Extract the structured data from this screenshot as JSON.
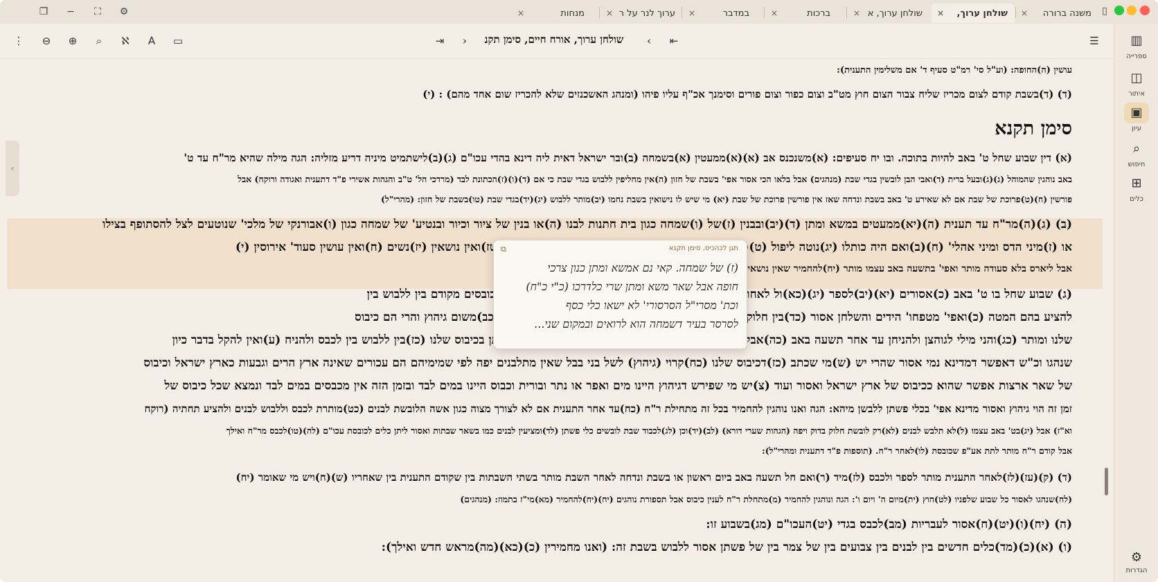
{
  "tabs": [
    {
      "label": "משנה ברורה",
      "active": false
    },
    {
      "label": "שולחן ערוך,",
      "active": true
    },
    {
      "label": "שולחן ערוך, א",
      "active": false
    },
    {
      "label": "ברכות",
      "active": false
    },
    {
      "label": "במדבר",
      "active": false
    },
    {
      "label": "ערוך לנר על ר",
      "active": false
    },
    {
      "label": "מנחות",
      "active": false
    }
  ],
  "tab_close_glyph": "×",
  "toolbar": {
    "title": "שולחן ערוך, אורח חיים, סימן תקנ",
    "icons": [
      "menu-icon",
      "first-page-icon",
      "prev-icon",
      "next-icon",
      "last-page-icon",
      "sidebar-toggle-icon",
      "font-size-icon",
      "nikud-icon",
      "search-icon",
      "zoom-in-icon",
      "zoom-out-icon",
      "more-icon"
    ]
  },
  "sidebar": {
    "items": [
      {
        "label": "ספרייה",
        "icon": "library-icon",
        "active": false
      },
      {
        "label": "איתור",
        "icon": "find-icon",
        "active": false
      },
      {
        "label": "עיון",
        "icon": "book-icon",
        "active": true
      },
      {
        "label": "חיפוש",
        "icon": "search-icon",
        "active": false
      },
      {
        "label": "כלים",
        "icon": "tools-icon",
        "active": false
      }
    ],
    "settings_label": "הגדרות"
  },
  "content": {
    "lines": [
      "עושין (ה)החופה: (וע\"ל סי' רמ\"ט סעיף ד' אם משלימין התענית):",
      "(ד) (ד)בשבת קודם לצום מכריז שליח צבור הצום חוץ מט\"ב וצום כפור וצום פורים וסימנך אכ\"ף עליו פיהו (ומנהג האשכנזים שלא להכריז שום אחד מהם) : (י)",
      "סימן תקנא",
      "(א) דין שבוע שחל ט' באב להיות בתוכה. ובו יח סעיפים: (א)משנכנס אב (א)(א)ממעטין (א)בשמחה (ב)ובר ישראל דאית ליה דינא בהדי עכו\"ם (ג)(ב)לישתמיט מיניה דריע מזליה: הגה מילה שהיא מר\"ח עד ט'",
      "באב נוהגין שהמוהל (ג)(ג)ובעל ברית (ד)ואבי הבן לובשין בגדי שבת (מנהגים) אבל בלאו הכי אסור אפי' בשבת של חזון (ה)אין מחליפין ללבוש בגדי שבת כי אם (ד)(ו)(ז)הכתונת לבד (מרדכי הל' ט\"ב והגהות אשירי פ\"ד דתענית ואגודה ורוקח) אבל",
      "פורשין (ח)(ט)פרוכת של שבת אם לא שאירע ט' באב בשבת ונדחה שאז אין פורשין פרוכת של שבת (יא) מי שיש לו נישואין בשבת נחמו (יב)מותר ללבוש (יג)(יד)בגדי שבת (טו)בשבת של חזון: (מהרי\"ל)",
      "(ב) (ג)(ה)מר\"ח עד תענית (ה)(יא)ממעטים במשא ומתן (ד)(יב)ובבנין (ז)של (ו)שמחה כגון בית חתנות לבנו (ה)או בנין של ציור וכיור ובנטיע' של שמחה כגון (ו)אבורנקי של מלכי' שנוטעים לצל להסתופף בצילו",
      "או (ז)מיני הדס ומיני אהלי' (ח)(ב)ואם היה כותלו (יג)נוטה ליפול (ט)(יד)(טו)מצוה הכל שרי) (ר\"ן ספ\"ק דתענית)(ט)(ע)(טז)ואין נושאין (יז)נשים (ח)ואין עושין סעוד' אירוסין (י)",
      "אבל ליארס בלא סעודה מותר ואפי' בתשעה באב עצמו מותר (יח)להחמיר שאין נושאים מי\"ז בתמוז ואילך עד אחר תשעה באב: (מנהגים):",
      "(ג) שבוע שחל בו ט' באב (כ)אסורים (יא)(יב)לספר (יג)(כא)ול לאחר ט' באב (ל)ואפי' אין לו אלא חלוק אחד אסור וכן המכובסים מקודם בין ללבוש בין",
      "להציע בהם המטה (כ)ואפי' מטפחו' הידים והשלחן אסור (כד)בין חלוק להחליקו. ערוך) שלנו אסור (כד)וכלי פשתן אין בהם (כב)משום גיהוץ והרי הם כיבוס",
      "שלנו ומותר (כג)והני מילי לגוהצן ולהניחן עד אחר תשעה באב (כה)אבל אסור ללבשן בשבוע זה (כו)ונהגו לאסור אפי' כלי פשתן בכיבוס שלנו (כז)בין ללבוש בין לכבס ולהניח (ע)ואין להקל בדבר כיון",
      "שנהגו וכ\"ש דאפשר דמדינא נמי אסור שהרי יש (ש)מי שכתב (כז)דכיבוס שלנו (כח)קרוי (גיהוץ) לשל בני בבל שאין מתלבנים יפה לפי שמימיהם הם עכורים שאינה ארץ הרים וגבעות כארץ ישראל וכיבוס",
      "של שאר ארצות אפשר שהוא ככיבוס של ארץ ישראל ואסור ועוד (צ)יש מי שפירש דגיהוץ היינו מים ואפר או נתר ובורית וכבוס היינו במים לבד ובזמן הזה אין מכבסים במים לבד ונמצא שכל כיבוס של",
      "זמן זה הוי גיהוץ ואסור מדינא אפי' בכלי פשתן ללבשן מיהא: הגה ואנו נוהגין להחמיר בכל זה מתחילת ר\"ח (כח)עד אחר התענית אם לא לצורך מצוה כגון אשה הלובשת לבנים (כט)מותרת לכבס וללבוש לבנים ולהציע תחתיה (רוקח",
      "וא\"ז) אבל (יג)בט' באב עצמו (ל)לא תלבש לבנים (לא)רק לובשת חלוק בדוק ויפה (הגהות שערי דורא) (לב)(יד)וכן (לג)לכבוד שבת לובשים כלי פשתן (לד)ומציעין לבנים כמו בשאר שבתות ואסור ליתן כלים לכובסת עכו\"ם (לה)(טו)לכבס מר\"ח ואילך",
      "אבל קודם ר\"ח מותר לתת אע\"פ שכובסת (לו)לאחר ר\"ח. (תוספות פ\"ד דתענית ומהרי\"ל):",
      "(ד) (ק)(עז)(לז)לאחר התענית מותר לספר ולכבס (לז)מיד (ר)ואם חל תשעה באב ביום ראשון או בשבת ונדחה לאחר השבת מותר בשתי השבתות בין שקודם התענית בין שאחריו (ש)(ח)ויש מי שאומר (יח)",
      "(לח)שנהגו לאסור כל שבוע שלפניו (לט)חוץ (ית)מיום ה' ויום ו': הגה ונוהגין להחמיר (מ)מתחלת ר\"ח לענין כיבוס אבל תספורת נוהגים (יח)(יח)להחמיר (מא)מי\"ז בתמוז: (מנהגים)",
      "(ה) (יח)(ו)(יט)(ח)אסור לעבריות (מב)לכבס בגדי (יט)העכו\"ם (מג)בשבוע זו:",
      "(ו) (א)(כ)(מד)כלים חדשים בין לבנים בין צבועים בין של צמר בין של פשתן אסור ללבוש בשבת זה: (ואנו מחמירין (כ)(כא)(מה)מראש חדש ואילך):"
    ]
  },
  "tooltip": {
    "header": "תגן לכהכיס, סימן תקנא",
    "lines": [
      "(ז) של שמחה. קאי נם אמשא ומתן כנון צרכי",
      "חופה אבל שאר משא ומתן שרי כלדרכו (כ\"י כ\"ח)",
      "וכת' מסרי\"ל הסרסורי' לא ישאו כלי כסף",
      "לסרסר בעיר דשמחה הוא לרואים ובמקום שני..."
    ]
  },
  "colors": {
    "background": "#f5eee6",
    "tabbar": "#ebe2d8",
    "highlight": "#f0e0cc",
    "sidebar_active": "#eedbb6",
    "accent_red": "#d42a1e",
    "traffic_red": "#ff5f57",
    "traffic_yellow": "#febc2e",
    "traffic_green": "#28c840"
  }
}
